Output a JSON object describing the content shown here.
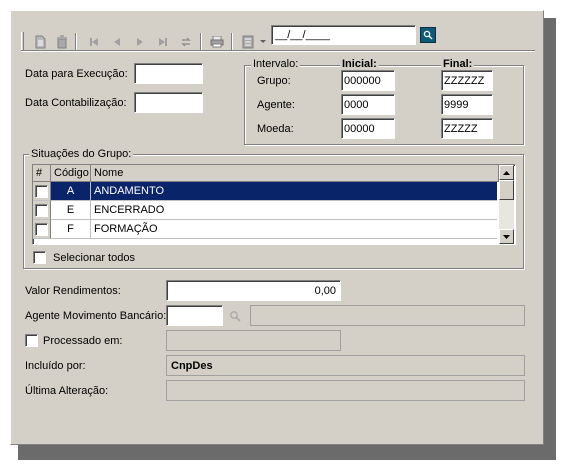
{
  "toolbar": {
    "date_value": "__/__/____"
  },
  "left_form": {
    "data_execucao_label": "Data para Execução:",
    "data_contabilizacao_label": "Data Contabilização:"
  },
  "intervalo": {
    "legend": "Intervalo:",
    "inicial_label": "Inicial:",
    "final_label": "Final:",
    "rows": [
      {
        "label": "Grupo:",
        "inicial": "000000",
        "final": "ZZZZZZ"
      },
      {
        "label": "Agente:",
        "inicial": "0000",
        "final": "9999"
      },
      {
        "label": "Moeda:",
        "inicial": "00000",
        "final": "ZZZZZ"
      }
    ]
  },
  "situacoes": {
    "legend": "Situações do Grupo:",
    "columns": [
      "#",
      "Código",
      "Nome"
    ],
    "rows": [
      {
        "codigo": "A",
        "nome": "ANDAMENTO",
        "selected": true
      },
      {
        "codigo": "E",
        "nome": "ENCERRADO",
        "selected": false
      },
      {
        "codigo": "F",
        "nome": "FORMAÇÃO",
        "selected": false
      }
    ],
    "select_all_label": "Selecionar todos"
  },
  "bottom_form": {
    "valor_rendimentos_label": "Valor Rendimentos:",
    "valor_rendimentos_value": "0,00",
    "agente_mov_label": "Agente Movimento Bancário:",
    "processado_label": "Processado em:",
    "incluido_label": "Incluído por:",
    "incluido_value": "CnpDes",
    "ultima_alteracao_label": "Última Alteração:"
  },
  "colors": {
    "window_bg": "#d4d0c8",
    "selection": "#0a246a",
    "search_button": "#0f5a78"
  }
}
